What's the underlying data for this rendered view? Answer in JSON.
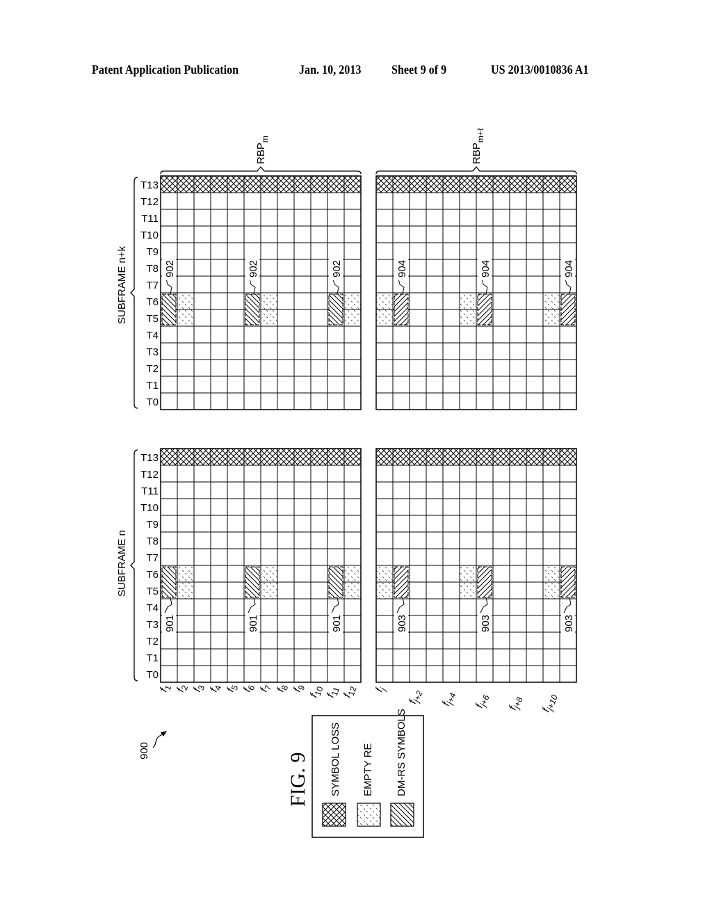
{
  "header": {
    "publication": "Patent Application Publication",
    "date": "Jan. 10, 2013",
    "sheet": "Sheet 9 of 9",
    "number": "US 2013/0010836 A1"
  },
  "figure": {
    "label": "FIG. 9",
    "reference": "900",
    "rows": [
      "T0",
      "T1",
      "T2",
      "T3",
      "T4",
      "T5",
      "T6",
      "T7",
      "T8",
      "T9",
      "T10",
      "T11",
      "T12",
      "T13"
    ],
    "columns_left": [
      "f1",
      "f2",
      "f3",
      "f4",
      "f5",
      "f6",
      "f7",
      "f8",
      "f9",
      "f10",
      "f11",
      "f12"
    ],
    "columns_right_labels": [
      {
        "col": 0,
        "base": "f",
        "sub": "j"
      },
      {
        "col": 2,
        "base": "f",
        "sub": "j+2"
      },
      {
        "col": 4,
        "base": "f",
        "sub": "j+4"
      },
      {
        "col": 6,
        "base": "f",
        "sub": "j+6"
      },
      {
        "col": 8,
        "base": "f",
        "sub": "j+8"
      },
      {
        "col": 10,
        "base": "f",
        "sub": "j+10"
      }
    ],
    "rbp_left": {
      "base": "RBP",
      "sub": "m"
    },
    "rbp_right": {
      "base": "RBP",
      "sub": "m+ℓ"
    },
    "subframes": [
      {
        "label": "SUBFRAME n+k",
        "position": "top"
      },
      {
        "label": "SUBFRAME n",
        "position": "bottom"
      }
    ],
    "symbol_loss_row": "T13",
    "dmrs_rows": [
      "T5",
      "T6"
    ],
    "grids": [
      {
        "id": "top-left",
        "subframe": "SUBFRAME n+k",
        "rbp": "RBP m",
        "dmrs_cols": [
          0,
          5,
          10
        ],
        "empty_cols": [
          1,
          6,
          11
        ],
        "callout": "902",
        "callout_side": "above",
        "hatch": "backslash"
      },
      {
        "id": "top-right",
        "subframe": "SUBFRAME n+k",
        "rbp": "RBP m+ℓ",
        "dmrs_cols": [
          1,
          6,
          11
        ],
        "empty_cols": [
          0,
          5,
          10
        ],
        "callout": "904",
        "callout_side": "above",
        "hatch": "slash"
      },
      {
        "id": "bottom-left",
        "subframe": "SUBFRAME n",
        "rbp": "RBP m",
        "dmrs_cols": [
          0,
          5,
          10
        ],
        "empty_cols": [
          1,
          6,
          11
        ],
        "callout": "901",
        "callout_side": "below",
        "hatch": "backslash"
      },
      {
        "id": "bottom-right",
        "subframe": "SUBFRAME n",
        "rbp": "RBP m+ℓ",
        "dmrs_cols": [
          1,
          6,
          11
        ],
        "empty_cols": [
          0,
          5,
          10
        ],
        "callout": "903",
        "callout_side": "below",
        "hatch": "slash"
      }
    ]
  },
  "legend": {
    "items": [
      {
        "label": "SYMBOL LOSS",
        "pattern": "crosshatch"
      },
      {
        "label": "EMPTY RE",
        "pattern": "dashes"
      },
      {
        "label": "DM-RS SYMBOLS",
        "pattern": "diagonal"
      }
    ]
  }
}
